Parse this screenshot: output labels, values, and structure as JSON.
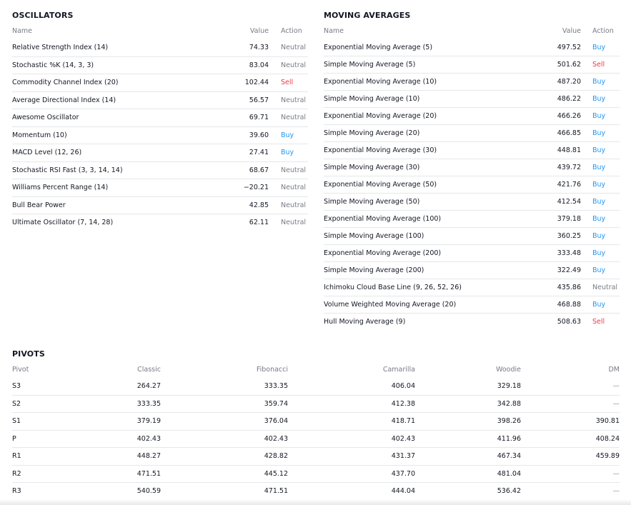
{
  "oscillators": {
    "title": "OSCILLATORS",
    "headers": {
      "name": "Name",
      "value": "Value",
      "action": "Action"
    },
    "rows": [
      {
        "name": "Relative Strength Index (14)",
        "value": "74.33",
        "action": "Neutral"
      },
      {
        "name": "Stochastic %K (14, 3, 3)",
        "value": "83.04",
        "action": "Neutral"
      },
      {
        "name": "Commodity Channel Index (20)",
        "value": "102.44",
        "action": "Sell"
      },
      {
        "name": "Average Directional Index (14)",
        "value": "56.57",
        "action": "Neutral"
      },
      {
        "name": "Awesome Oscillator",
        "value": "69.71",
        "action": "Neutral"
      },
      {
        "name": "Momentum (10)",
        "value": "39.60",
        "action": "Buy"
      },
      {
        "name": "MACD Level (12, 26)",
        "value": "27.41",
        "action": "Buy"
      },
      {
        "name": "Stochastic RSI Fast (3, 3, 14, 14)",
        "value": "68.67",
        "action": "Neutral"
      },
      {
        "name": "Williams Percent Range (14)",
        "value": "−20.21",
        "action": "Neutral"
      },
      {
        "name": "Bull Bear Power",
        "value": "42.85",
        "action": "Neutral"
      },
      {
        "name": "Ultimate Oscillator (7, 14, 28)",
        "value": "62.11",
        "action": "Neutral"
      }
    ]
  },
  "moving_averages": {
    "title": "MOVING AVERAGES",
    "headers": {
      "name": "Name",
      "value": "Value",
      "action": "Action"
    },
    "rows": [
      {
        "name": "Exponential Moving Average (5)",
        "value": "497.52",
        "action": "Buy"
      },
      {
        "name": "Simple Moving Average (5)",
        "value": "501.62",
        "action": "Sell"
      },
      {
        "name": "Exponential Moving Average (10)",
        "value": "487.20",
        "action": "Buy"
      },
      {
        "name": "Simple Moving Average (10)",
        "value": "486.22",
        "action": "Buy"
      },
      {
        "name": "Exponential Moving Average (20)",
        "value": "466.26",
        "action": "Buy"
      },
      {
        "name": "Simple Moving Average (20)",
        "value": "466.85",
        "action": "Buy"
      },
      {
        "name": "Exponential Moving Average (30)",
        "value": "448.81",
        "action": "Buy"
      },
      {
        "name": "Simple Moving Average (30)",
        "value": "439.72",
        "action": "Buy"
      },
      {
        "name": "Exponential Moving Average (50)",
        "value": "421.76",
        "action": "Buy"
      },
      {
        "name": "Simple Moving Average (50)",
        "value": "412.54",
        "action": "Buy"
      },
      {
        "name": "Exponential Moving Average (100)",
        "value": "379.18",
        "action": "Buy"
      },
      {
        "name": "Simple Moving Average (100)",
        "value": "360.25",
        "action": "Buy"
      },
      {
        "name": "Exponential Moving Average (200)",
        "value": "333.48",
        "action": "Buy"
      },
      {
        "name": "Simple Moving Average (200)",
        "value": "322.49",
        "action": "Buy"
      },
      {
        "name": "Ichimoku Cloud Base Line (9, 26, 52, 26)",
        "value": "435.86",
        "action": "Neutral"
      },
      {
        "name": "Volume Weighted Moving Average (20)",
        "value": "468.88",
        "action": "Buy"
      },
      {
        "name": "Hull Moving Average (9)",
        "value": "508.63",
        "action": "Sell"
      }
    ]
  },
  "pivots": {
    "title": "PIVOTS",
    "headers": {
      "pivot": "Pivot",
      "classic": "Classic",
      "fibonacci": "Fibonacci",
      "camarilla": "Camarilla",
      "woodie": "Woodie",
      "dm": "DM"
    },
    "rows": [
      {
        "pivot": "S3",
        "classic": "264.27",
        "fibonacci": "333.35",
        "camarilla": "406.04",
        "woodie": "329.18",
        "dm": "—"
      },
      {
        "pivot": "S2",
        "classic": "333.35",
        "fibonacci": "359.74",
        "camarilla": "412.38",
        "woodie": "342.88",
        "dm": "—"
      },
      {
        "pivot": "S1",
        "classic": "379.19",
        "fibonacci": "376.04",
        "camarilla": "418.71",
        "woodie": "398.26",
        "dm": "390.81"
      },
      {
        "pivot": "P",
        "classic": "402.43",
        "fibonacci": "402.43",
        "camarilla": "402.43",
        "woodie": "411.96",
        "dm": "408.24"
      },
      {
        "pivot": "R1",
        "classic": "448.27",
        "fibonacci": "428.82",
        "camarilla": "431.37",
        "woodie": "467.34",
        "dm": "459.89"
      },
      {
        "pivot": "R2",
        "classic": "471.51",
        "fibonacci": "445.12",
        "camarilla": "437.70",
        "woodie": "481.04",
        "dm": "—"
      },
      {
        "pivot": "R3",
        "classic": "540.59",
        "fibonacci": "471.51",
        "camarilla": "444.04",
        "woodie": "536.42",
        "dm": "—"
      }
    ]
  },
  "colors": {
    "buy": "#2196f3",
    "sell": "#f23645",
    "neutral": "#787b86",
    "divider": "#e6e7ea"
  }
}
